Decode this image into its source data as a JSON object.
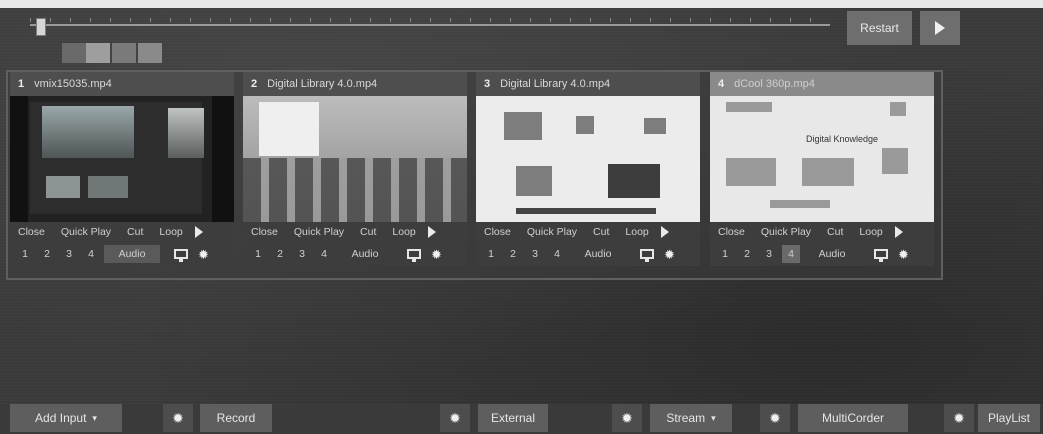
{
  "transport": {
    "restart_label": "Restart",
    "play_icon": "play-icon",
    "swatch_colors": [
      "#6a6a6a",
      "#9e9e9e",
      "#7a7a7a",
      "#8a8a8a"
    ]
  },
  "inputs": [
    {
      "number": "1",
      "title": "vmix15035.mp4",
      "controls": [
        "Close",
        "Quick Play",
        "Cut",
        "Loop"
      ],
      "layers": [
        "1",
        "2",
        "3",
        "4"
      ],
      "audio_label": "Audio",
      "active": false
    },
    {
      "number": "2",
      "title": "Digital Library 4.0.mp4",
      "controls": [
        "Close",
        "Quick Play",
        "Cut",
        "Loop"
      ],
      "layers": [
        "1",
        "2",
        "3",
        "4"
      ],
      "audio_label": "Audio",
      "active": false
    },
    {
      "number": "3",
      "title": "Digital Library 4.0.mp4",
      "controls": [
        "Close",
        "Quick Play",
        "Cut",
        "Loop"
      ],
      "layers": [
        "1",
        "2",
        "3",
        "4"
      ],
      "audio_label": "Audio",
      "active": false
    },
    {
      "number": "4",
      "title": "dCool 360p.mp4",
      "controls": [
        "Close",
        "Quick Play",
        "Cut",
        "Loop"
      ],
      "layers": [
        "1",
        "2",
        "3",
        "4"
      ],
      "audio_label": "Audio",
      "active": true,
      "preview_text": "Digital Knowledge"
    }
  ],
  "bottom_bar": {
    "add_input_label": "Add Input",
    "record_label": "Record",
    "external_label": "External",
    "stream_label": "Stream",
    "multicorder_label": "MultiCorder",
    "playlist_label": "PlayList"
  },
  "colors": {
    "panel_bg": "#3a3a3a",
    "button_bg": "#5e5e5e",
    "active_header": "#8a8a8a"
  }
}
